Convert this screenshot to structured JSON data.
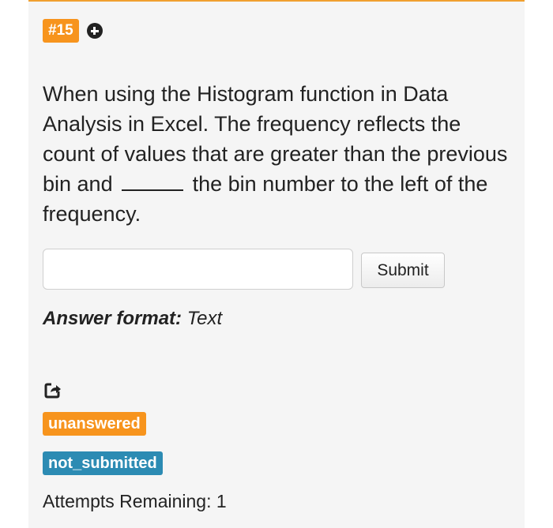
{
  "question": {
    "number": "#15",
    "text_before": "When using the Histogram function in Data Analysis in Excel. The frequency reflects the count of values that are greater than the previous bin and",
    "text_after": "the bin number to the left of the frequency.",
    "icons": {
      "add": "plus-circle-icon",
      "share": "share-icon"
    }
  },
  "answer": {
    "value": "",
    "placeholder": "",
    "submit_label": "Submit"
  },
  "answer_format": {
    "label": "Answer format:",
    "value": "Text"
  },
  "status": {
    "answered": "unanswered",
    "submitted": "not_submitted"
  },
  "attempts": "Attempts Remaining: 1",
  "colors": {
    "orange": "#f7941d",
    "blue": "#2c8bb3",
    "panel_bg": "#f5f5f5"
  }
}
